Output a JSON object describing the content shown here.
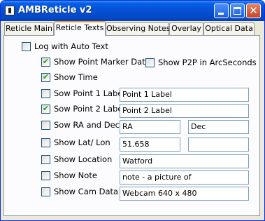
{
  "window": {
    "title": "AMBReticle v2",
    "accent": "#0453d6"
  },
  "tabs": [
    {
      "label": "Reticle Main",
      "active": false
    },
    {
      "label": "Reticle Texts",
      "active": true
    },
    {
      "label": "Observing Notes",
      "active": false
    },
    {
      "label": "Overlay",
      "active": false
    },
    {
      "label": "Optical Data",
      "active": false
    }
  ],
  "log_auto_text": {
    "label": "Log with Auto Text",
    "checked": false
  },
  "show_point_marker": {
    "label": "Show Point Marker Data",
    "checked": true
  },
  "show_p2p": {
    "label": "Show P2P in ArcSeconds",
    "checked": false
  },
  "show_time": {
    "label": "Show Time",
    "checked": true
  },
  "point1": {
    "label": "Sow Point 1 Label",
    "checked": false,
    "value": "Point 1 Label"
  },
  "point2": {
    "label": "Sow Point 2 Label",
    "checked": true,
    "value": "Point 2 Label"
  },
  "ra_dec": {
    "label": "Sow RA and Dec.",
    "checked": false,
    "ra_value": "RA",
    "dec_value": "Dec"
  },
  "lat_lon": {
    "label": "Show Lat/ Lon",
    "checked": false,
    "lat_value": "51.658",
    "lon_value": ""
  },
  "location": {
    "label": "Show Location",
    "checked": false,
    "value": "Watford"
  },
  "note": {
    "label": "Show Note",
    "checked": false,
    "value": "note - a picture of"
  },
  "cam_data": {
    "label": "Show Cam Data",
    "checked": false,
    "value": "Webcam 640 x 480"
  }
}
